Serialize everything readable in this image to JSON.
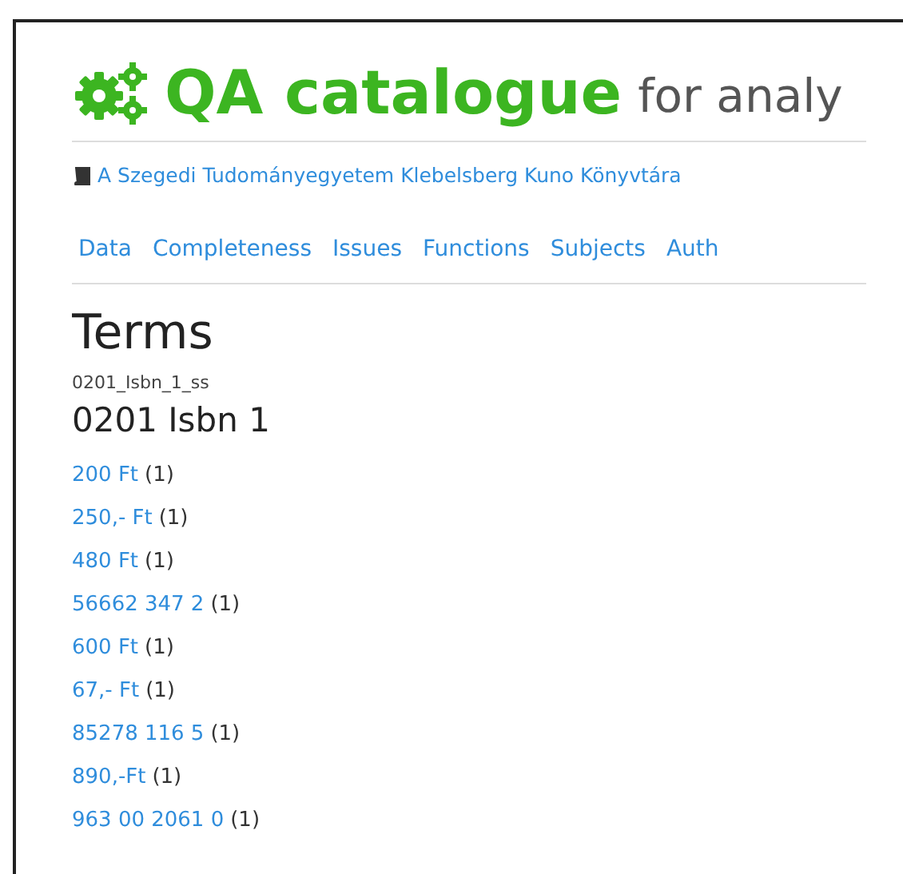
{
  "header": {
    "title": "QA catalogue",
    "subtitle": "for analy"
  },
  "library": {
    "name": "A Szegedi Tudományegyetem Klebelsberg Kuno Könyvtára"
  },
  "nav": [
    {
      "label": "Data"
    },
    {
      "label": "Completeness"
    },
    {
      "label": "Issues"
    },
    {
      "label": "Functions"
    },
    {
      "label": "Subjects"
    },
    {
      "label": "Auth"
    }
  ],
  "page": {
    "title": "Terms",
    "field_id": "0201_Isbn_1_ss",
    "field_label": "0201 Isbn 1"
  },
  "terms": [
    {
      "term": "200 Ft",
      "count": "(1)"
    },
    {
      "term": "250,- Ft",
      "count": "(1)"
    },
    {
      "term": "480 Ft",
      "count": "(1)"
    },
    {
      "term": "56662 347 2",
      "count": "(1)"
    },
    {
      "term": "600 Ft",
      "count": "(1)"
    },
    {
      "term": "67,- Ft",
      "count": "(1)"
    },
    {
      "term": "85278 116 5",
      "count": "(1)"
    },
    {
      "term": "890,-Ft",
      "count": "(1)"
    },
    {
      "term": "963 00 2061 0",
      "count": "(1)"
    }
  ]
}
